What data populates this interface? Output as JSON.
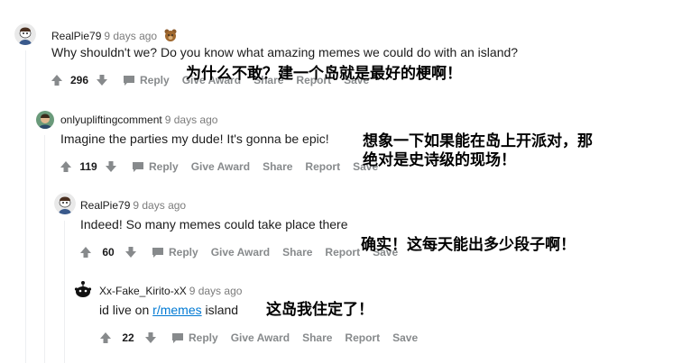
{
  "comments": [
    {
      "author": "RealPie79",
      "time": "9 days ago",
      "flair_icon": "bear-flair-icon",
      "body": "Why shouldn't we? Do you know what amazing memes we could do with an island?",
      "score": "296",
      "reply_label": "Reply",
      "give_award_label": "Give Award",
      "share_label": "Share",
      "report_label": "Report",
      "save_label": "Save"
    },
    {
      "author": "onlyupliftingcomment",
      "time": "9 days ago",
      "body": "Imagine the parties my dude! It's gonna be epic!",
      "score": "119",
      "reply_label": "Reply",
      "give_award_label": "Give Award",
      "share_label": "Share",
      "report_label": "Report",
      "save_label": "Save"
    },
    {
      "author": "RealPie79",
      "time": "9 days ago",
      "body": "Indeed! So many memes could take place there",
      "score": "60",
      "reply_label": "Reply",
      "give_award_label": "Give Award",
      "share_label": "Share",
      "report_label": "Report",
      "save_label": "Save"
    },
    {
      "author": "Xx-Fake_Kirito-xX",
      "time": "9 days ago",
      "body_pre": "id live on ",
      "body_link": "r/memes",
      "body_post": " island",
      "score": "22",
      "reply_label": "Reply",
      "give_award_label": "Give Award",
      "share_label": "Share",
      "report_label": "Report",
      "save_label": "Save"
    }
  ],
  "captions": {
    "c1": "为什么不敢？建一个岛就是最好的梗啊！",
    "c2_line1": "想象一下如果能在岛上开派对，那",
    "c2_line2": "绝对是史诗级的现场！",
    "c3": "确实！这每天能出多少段子啊！",
    "c4": "这岛我住定了！"
  },
  "colors": {
    "upvote": "#878a8c",
    "link": "#0079d3",
    "meta_gray": "#7c7c7c",
    "thread_line": "#edeff1"
  }
}
